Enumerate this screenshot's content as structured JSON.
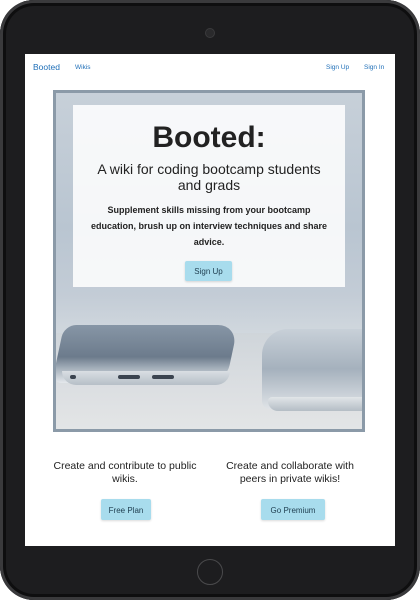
{
  "navbar": {
    "brand": "Booted",
    "wikis": "Wikis",
    "sign_up": "Sign Up",
    "sign_in": "Sign In"
  },
  "hero": {
    "title": "Booted:",
    "subtitle": "A wiki for coding bootcamp students and grads",
    "description": "Supplement skills missing from your bootcamp education, brush up on interview techniques and share advice.",
    "button": "Sign Up"
  },
  "features": [
    {
      "text": "Create and contribute to public wikis.",
      "button": "Free Plan"
    },
    {
      "text": "Create and collaborate with peers in private wikis!",
      "button": "Go Premium"
    }
  ],
  "colors": {
    "link": "#1f6fb8",
    "button_bg": "#a8dced",
    "device_frame": "#1d1d1f"
  }
}
